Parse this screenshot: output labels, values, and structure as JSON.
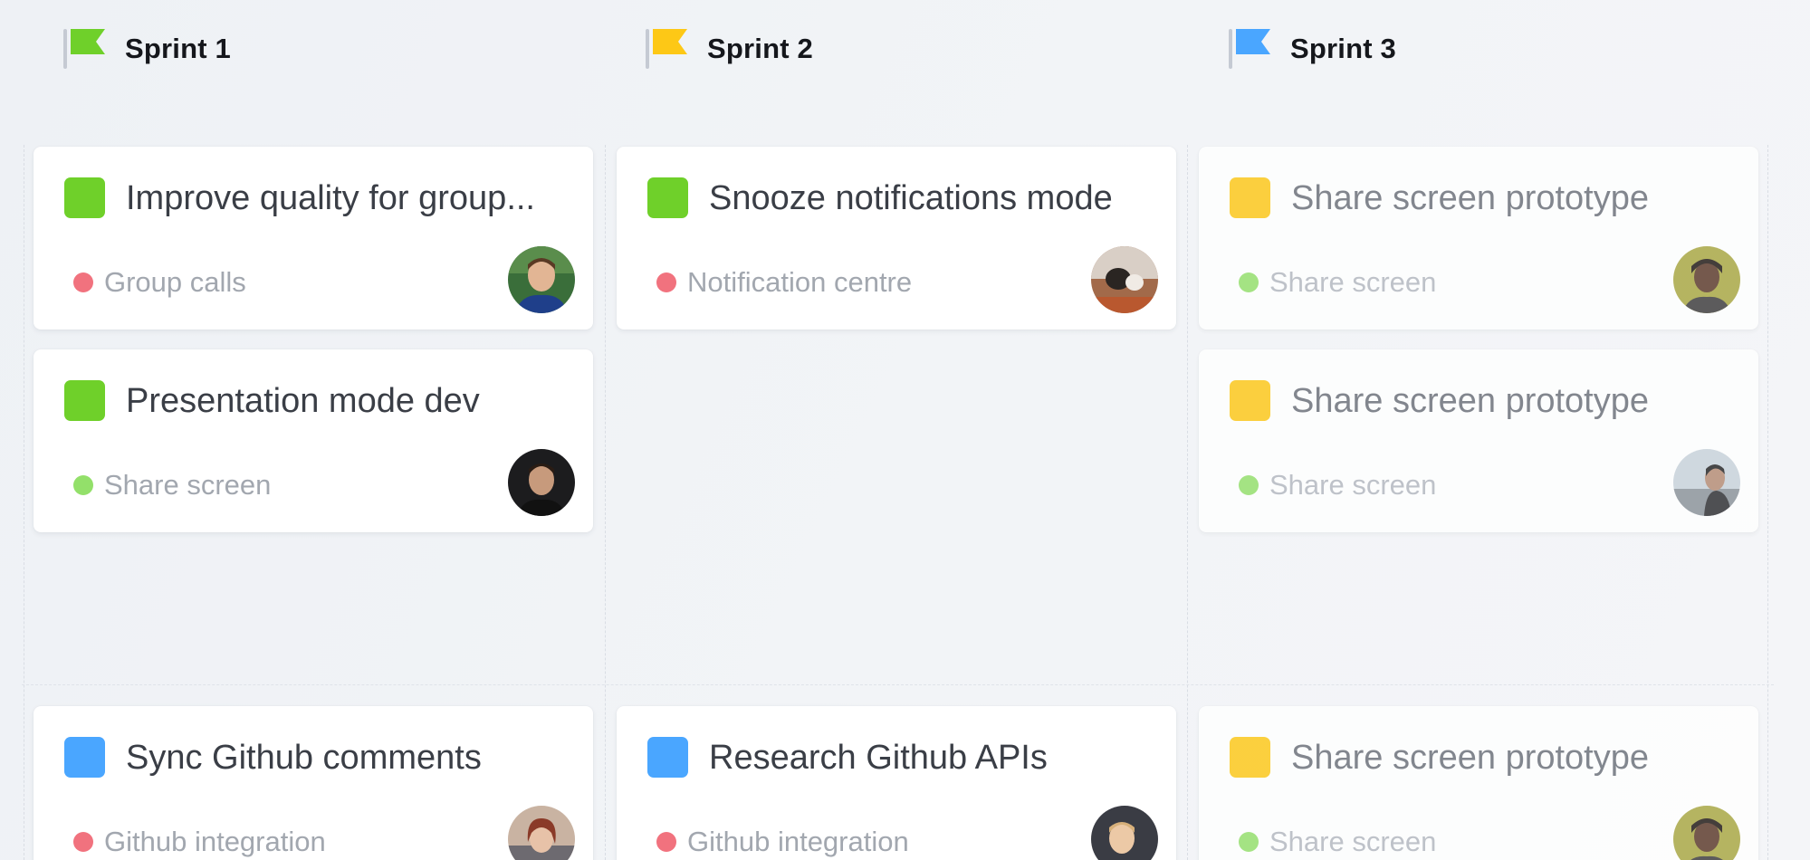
{
  "colors": {
    "green": "#6fd02a",
    "yellow": "#fdc816",
    "blue": "#4aa6ff",
    "red_dot": "#f1727e",
    "green_dot": "#93e06a"
  },
  "sprints": [
    {
      "title": "Sprint 1",
      "flag_color": "#6fd02a",
      "cards": [
        {
          "title": "Improve quality for group...",
          "status": "green",
          "tag": "Group calls",
          "tag_dot": "red"
        },
        {
          "title": "Presentation mode dev",
          "status": "green",
          "tag": "Share screen",
          "tag_dot": "green"
        },
        {
          "title": "Sync Github comments",
          "status": "blue",
          "tag": "Github integration",
          "tag_dot": "red"
        }
      ]
    },
    {
      "title": "Sprint 2",
      "flag_color": "#fdc816",
      "cards": [
        {
          "title": "Snooze notifications mode",
          "status": "green",
          "tag": "Notification centre",
          "tag_dot": "red"
        },
        {
          "title": "Research Github APIs",
          "status": "blue",
          "tag": "Github integration",
          "tag_dot": "red"
        }
      ]
    },
    {
      "title": "Sprint 3",
      "flag_color": "#4aa6ff",
      "cards": [
        {
          "title": "Share screen prototype",
          "status": "yellow",
          "tag": "Share screen",
          "tag_dot": "green"
        },
        {
          "title": "Share screen prototype",
          "status": "yellow",
          "tag": "Share screen",
          "tag_dot": "green"
        },
        {
          "title": "Share screen prototype",
          "status": "yellow",
          "tag": "Share screen",
          "tag_dot": "green"
        }
      ]
    }
  ]
}
